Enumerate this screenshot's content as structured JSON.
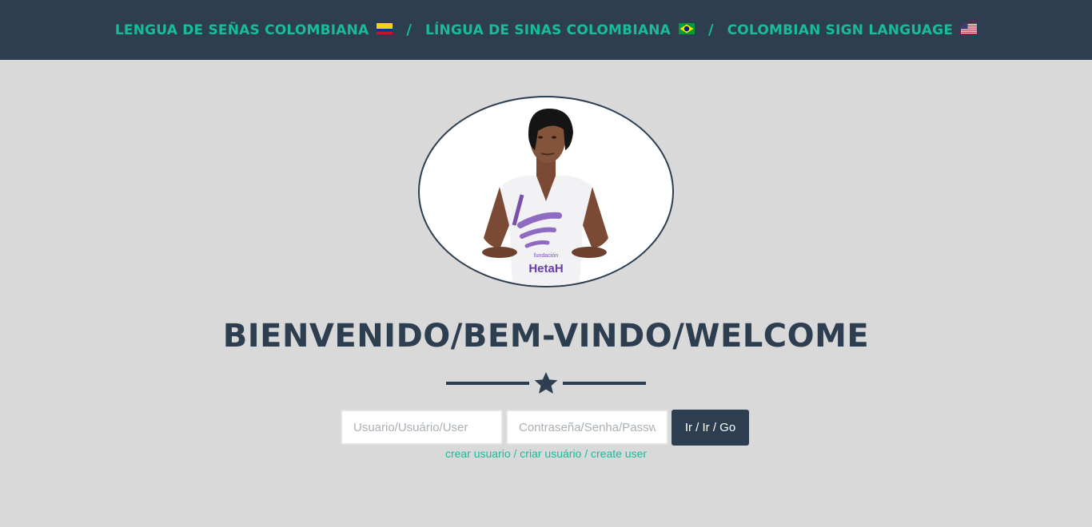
{
  "nav": {
    "links": [
      {
        "label": "LENGUA DE SEÑAS COLOMBIANA",
        "flag": "colombia-flag-icon"
      },
      {
        "label": "LÍNGUA DE SINAS COLOMBIANA",
        "flag": "brazil-flag-icon"
      },
      {
        "label": "COLOMBIAN SIGN LANGUAGE",
        "flag": "usa-flag-icon"
      }
    ],
    "separator": "/"
  },
  "avatar": {
    "shirt_logo_text": "HetaH",
    "shirt_logo_subtext": "fundación"
  },
  "welcome_title": "BIENVENIDO/BEM-VINDO/WELCOME",
  "login": {
    "user_placeholder": "Usuario/Usuário/User",
    "password_placeholder": "Contraseña/Senha/Password",
    "go_label": "Ir / Ir / Go",
    "create_user_link": "crear usuario / criar usuário / create user"
  },
  "colors": {
    "navbar": "#2c3e50",
    "accent": "#18bc9c",
    "background": "#d9d9d9",
    "primary_dark": "#2c3e50"
  }
}
